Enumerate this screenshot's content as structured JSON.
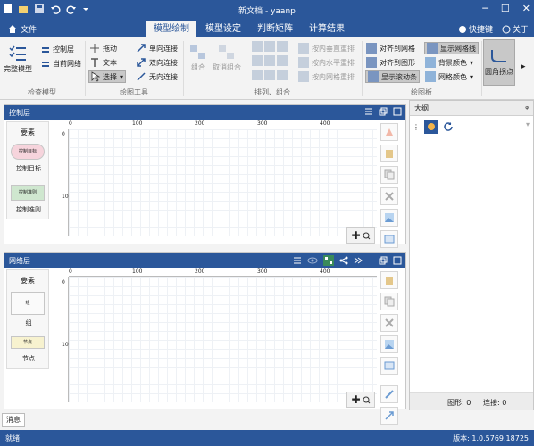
{
  "window": {
    "title": "新文档 - yaanp",
    "min": "─",
    "max": "☐",
    "close": "✕"
  },
  "tabs": {
    "file": "文件",
    "items": [
      "模型绘制",
      "模型设定",
      "判断矩阵",
      "计算结果"
    ],
    "active": 0,
    "shortcut": "快捷键",
    "about": "关于"
  },
  "ribbon": {
    "check_model": "完整模型",
    "control_layer": "控制层",
    "current_grid": "当前网络",
    "drag": "拖动",
    "text": "文本",
    "select": "选择",
    "one_way": "单向连接",
    "two_way": "双向连接",
    "no_dir": "无向连接",
    "group_btn": "组合",
    "ungroup_btn": "取消组合",
    "v_space": "按内垂直重排",
    "h_space": "按内水平重排",
    "grid_space": "按内网格重排",
    "align_grid": "对齐到网格",
    "align_shape": "对齐到图形",
    "show_scroll": "显示滚动条",
    "show_grid": "显示网格线",
    "bg_color": "背景颜色",
    "grid_color": "网格颜色",
    "rounded": "圆角拐点",
    "groups": {
      "check": "检查模型",
      "draw_tools": "绘图工具",
      "arrange": "排列、组合",
      "drawing": "绘图板"
    }
  },
  "control_panel": {
    "title": "控制层",
    "palette_title": "要素",
    "items": [
      {
        "label": "控制目标",
        "shape_text": "控制目标"
      },
      {
        "label": "控制准则",
        "shape_text": "控制准则"
      }
    ],
    "ruler_h": [
      "0",
      "100",
      "200",
      "300",
      "400"
    ],
    "ruler_v": [
      "0",
      "100"
    ]
  },
  "network_panel": {
    "title": "网络层",
    "palette_title": "要素",
    "items": [
      {
        "label": "组",
        "shape_text": "组"
      },
      {
        "label": "节点",
        "shape_text": "节点"
      }
    ],
    "ruler_h": [
      "0",
      "100",
      "200",
      "300",
      "400"
    ],
    "ruler_v": [
      "0",
      "100"
    ]
  },
  "outline": {
    "title": "大纲",
    "pin": "ᵩ",
    "shapes_label": "图形: 0",
    "links_label": "连接: 0"
  },
  "message_tab": "消息",
  "status": {
    "left": "就绪",
    "version": "版本: 1.0.5769.18725"
  },
  "colors": {
    "brand": "#2b579a",
    "control_shape": "#f6d4dc",
    "control_rule": "#cfe7cf",
    "node": "#f7f2cf"
  }
}
